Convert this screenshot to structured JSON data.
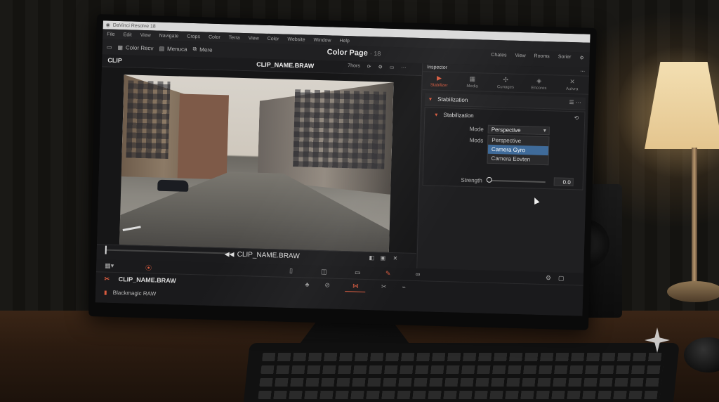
{
  "window": {
    "title": "DaVinci Resolve 18"
  },
  "menu": [
    "File",
    "Edit",
    "View",
    "Navigate",
    "Crops",
    "Color",
    "Terra",
    "View",
    "Color",
    "Website",
    "Window",
    "Help"
  ],
  "toolbar": {
    "item1": "Color Recv",
    "item2": "Menuca",
    "item3": "Mere"
  },
  "page_title": {
    "name": "Color Page",
    "version": "· 18"
  },
  "right_tools": [
    "Chates",
    "View",
    "Rooms",
    "Sorier"
  ],
  "subbar": {
    "clip_label": "CLIP",
    "clip_name": "CLIP_NAME.BRAW",
    "zoom": "7hors"
  },
  "viewer": {
    "clip_name": "CLIP_NAME.BRAW",
    "rewind": "◀◀"
  },
  "inspector": {
    "header": "Inspector",
    "tabs": [
      {
        "label": "Stabilizer",
        "icon": "video-icon",
        "active": true
      },
      {
        "label": "Media",
        "icon": "media-icon",
        "active": false
      },
      {
        "label": "Cunages",
        "icon": "transform-icon",
        "active": false
      },
      {
        "label": "Encores",
        "icon": "effects-icon",
        "active": false
      },
      {
        "label": "Autvra",
        "icon": "tools-icon",
        "active": false
      }
    ],
    "section_title": "Stabilization",
    "group_title": "Stabilization",
    "mode_label": "Mode",
    "mode_value": "Perspective",
    "mods_label": "Mods",
    "options": [
      "Perspective",
      "Camera Gyro",
      "Camera Eovten"
    ],
    "selected_option": "Camera Gyro",
    "strength_label": "Strength",
    "strength_value": "0.0"
  },
  "footer": {
    "clip_name": "CLIP_NAME.BRAW",
    "format": "Blackmagic RAW"
  },
  "colors": {
    "accent": "#d95b3f",
    "selection": "#3f6b9a",
    "panel": "#1f1f21"
  }
}
